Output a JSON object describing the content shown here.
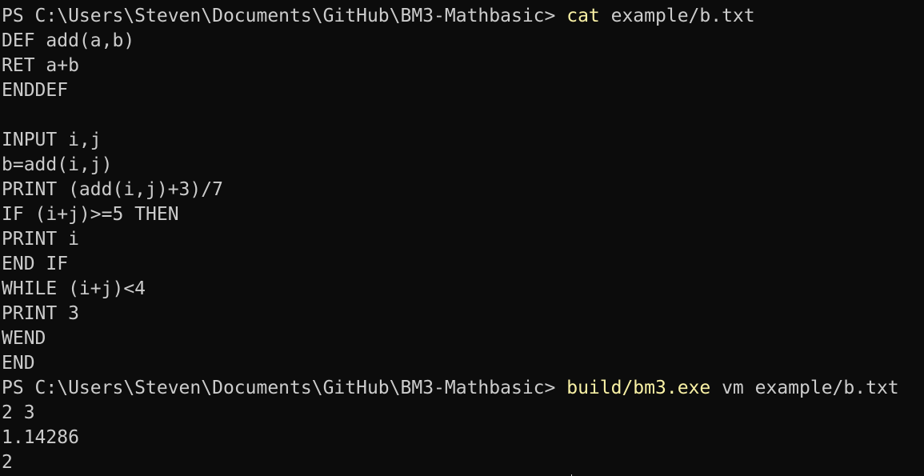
{
  "terminal": {
    "prompt1": {
      "path": "PS C:\\Users\\Steven\\Documents\\GitHub\\BM3-Mathbasic> ",
      "command": "cat",
      "args": " example/b.txt"
    },
    "file_lines": [
      "DEF add(a,b)",
      "RET a+b",
      "ENDDEF",
      "",
      "INPUT i,j",
      "b=add(i,j)",
      "PRINT (add(i,j)+3)/7",
      "IF (i+j)>=5 THEN",
      "PRINT i",
      "END IF",
      "WHILE (i+j)<4",
      "PRINT 3",
      "WEND",
      "END"
    ],
    "prompt2": {
      "path": "PS C:\\Users\\Steven\\Documents\\GitHub\\BM3-Mathbasic> ",
      "command": "build/bm3.exe",
      "args": " vm example/b.txt"
    },
    "output_lines": [
      "2 3",
      "1.14286",
      "2"
    ],
    "colors": {
      "background": "#0c0c0c",
      "text": "#cccccc",
      "command": "#f9f1a5"
    }
  }
}
